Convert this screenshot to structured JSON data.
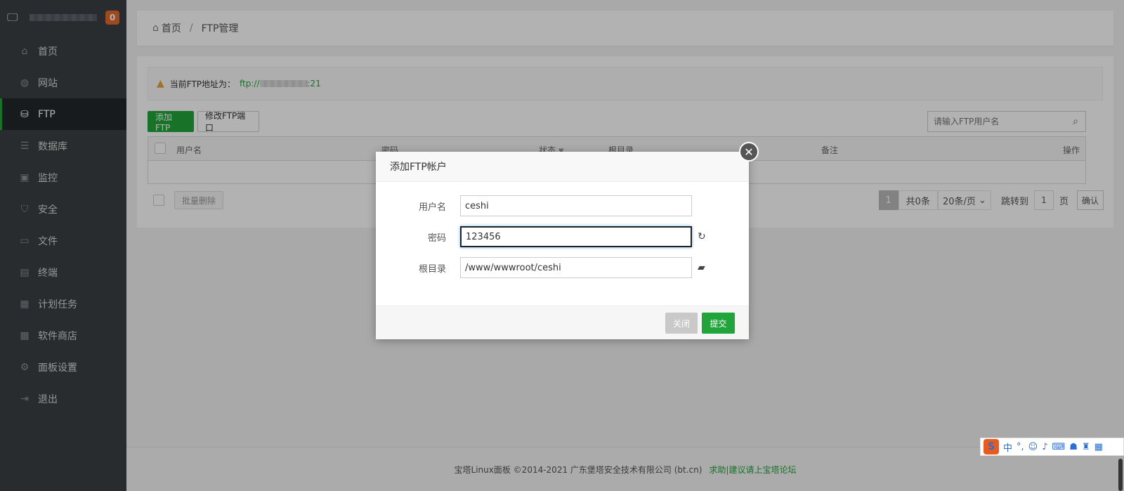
{
  "sidebar": {
    "notify_count": "0",
    "items": [
      {
        "label": "首页",
        "icon": "home-icon",
        "glyph": "⌂"
      },
      {
        "label": "网站",
        "icon": "globe-icon",
        "glyph": "◍"
      },
      {
        "label": "FTP",
        "icon": "ftp-icon",
        "glyph": "⛁"
      },
      {
        "label": "数据库",
        "icon": "database-icon",
        "glyph": "☰"
      },
      {
        "label": "监控",
        "icon": "monitor-icon",
        "glyph": "▣"
      },
      {
        "label": "安全",
        "icon": "shield-icon",
        "glyph": "⛉"
      },
      {
        "label": "文件",
        "icon": "folder-icon",
        "glyph": "▭"
      },
      {
        "label": "终端",
        "icon": "terminal-icon",
        "glyph": "▤"
      },
      {
        "label": "计划任务",
        "icon": "calendar-icon",
        "glyph": "▦"
      },
      {
        "label": "软件商店",
        "icon": "apps-icon",
        "glyph": "▩"
      },
      {
        "label": "面板设置",
        "icon": "gear-icon",
        "glyph": "⚙"
      },
      {
        "label": "退出",
        "icon": "logout-icon",
        "glyph": "⇥"
      }
    ],
    "active_index": 2
  },
  "breadcrumb": {
    "home": "首页",
    "sep": "/",
    "current": "FTP管理"
  },
  "alert": {
    "label": "当前FTP地址为：",
    "addr_prefix": "ftp://",
    "addr_suffix": ":21"
  },
  "toolbar": {
    "add_label": "添加FTP",
    "port_label": "修改FTP端口",
    "search_placeholder": "请输入FTP用户名"
  },
  "table": {
    "headers": {
      "username": "用户名",
      "password": "密码",
      "status": "状态",
      "root": "根目录",
      "note": "备注",
      "action": "操作"
    }
  },
  "batch_delete": "批量删除",
  "pager": {
    "current": "1",
    "total": "共0条",
    "per_page": "20条/页",
    "jump_to": "跳转到",
    "jump_value": "1",
    "page_unit": "页",
    "confirm": "确认"
  },
  "footer": {
    "copyright": "宝塔Linux面板 ©2014-2021 广东堡塔安全技术有限公司 (bt.cn)",
    "link": "求助|建议请上宝塔论坛"
  },
  "modal": {
    "title": "添加FTP帐户",
    "fields": {
      "username_label": "用户名",
      "username_value": "ceshi",
      "password_label": "密码",
      "password_value": "123456",
      "root_label": "根目录",
      "root_value": "/www/wwwroot/ceshi"
    },
    "close_label": "关闭",
    "submit_label": "提交"
  },
  "ime": {
    "lang": "中",
    "punct": "°,"
  }
}
